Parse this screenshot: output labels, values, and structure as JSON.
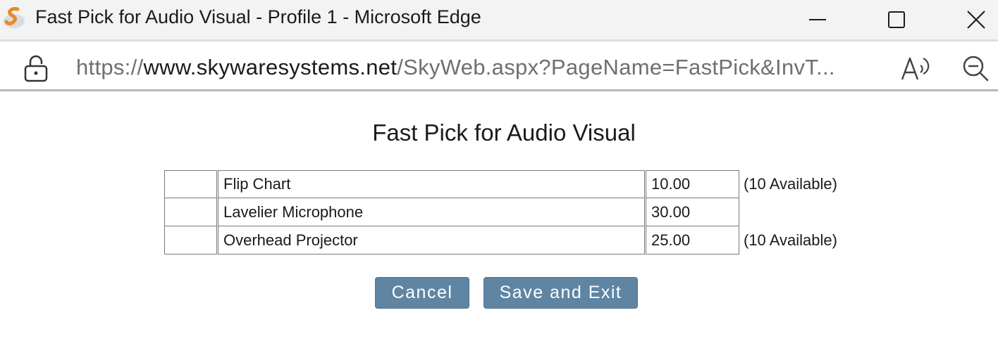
{
  "window": {
    "title": "Fast Pick for Audio Visual - Profile 1 - Microsoft Edge",
    "icons": [
      "app-icon",
      "minimize-icon",
      "maximize-icon",
      "close-icon"
    ]
  },
  "address_bar": {
    "url_protocol": "https://",
    "url_host": "www.skywaresystems.net",
    "url_path": "/SkyWeb.aspx?PageName=FastPick&InvT...",
    "icons": [
      "lock-icon",
      "read-aloud-icon",
      "zoom-out-icon"
    ]
  },
  "page": {
    "title": "Fast Pick for Audio Visual",
    "items": [
      {
        "qty": "",
        "description": "Flip Chart",
        "price": "10.00",
        "availability": "(10 Available)"
      },
      {
        "qty": "",
        "description": "Lavelier Microphone",
        "price": "30.00",
        "availability": ""
      },
      {
        "qty": "",
        "description": "Overhead Projector",
        "price": "25.00",
        "availability": "(10 Available)"
      }
    ],
    "buttons": {
      "cancel": "Cancel",
      "save": "Save and Exit"
    }
  },
  "colors": {
    "button_bg": "#5f85a3",
    "button_text": "#ffffff",
    "titlebar_bg": "#f3f3f3",
    "app_icon_orange": "#e8892b"
  }
}
